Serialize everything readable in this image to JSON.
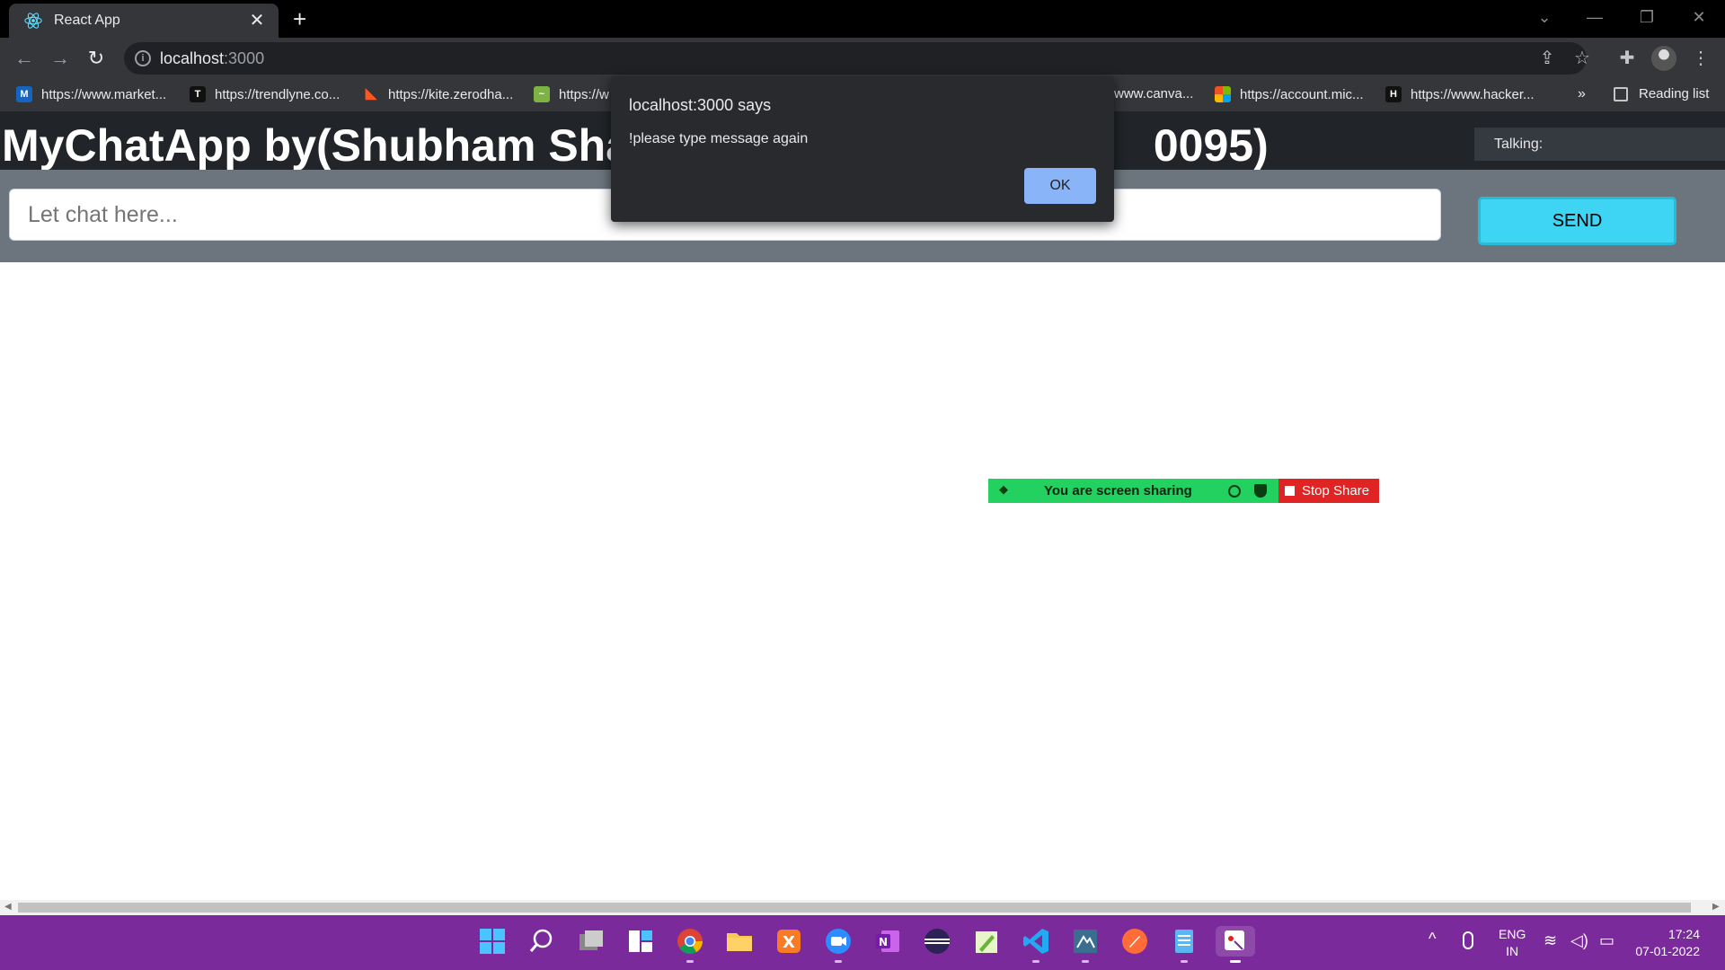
{
  "browser": {
    "tab_title": "React App",
    "tab_close": "✕",
    "new_tab": "+",
    "address": "localhost",
    "address_port": ":3000",
    "bookmarks": [
      {
        "label": "https://www.market...",
        "icon": "marketsmith-icon",
        "color": "#1565c0",
        "glyph": "M"
      },
      {
        "label": "https://trendlyne.co...",
        "icon": "trendlyne-icon",
        "color": "#111111",
        "glyph": "T"
      },
      {
        "label": "https://kite.zerodha...",
        "icon": "kite-icon",
        "color": "#ff5722",
        "glyph": "◣"
      },
      {
        "label": "https://w",
        "icon": "tradingview-icon",
        "color": "#7cb342",
        "glyph": "ꟿ"
      },
      {
        "label": "www.canva...",
        "icon": "canva-icon",
        "color": "#35363a",
        "glyph": ""
      },
      {
        "label": "https://account.mic...",
        "icon": "microsoft-icon",
        "color": "#f25022",
        "glyph": ""
      },
      {
        "label": "https://www.hacker...",
        "icon": "hackerrank-icon",
        "color": "#111111",
        "glyph": "H"
      }
    ],
    "bookmarks_more": "»",
    "reading_list": "Reading list"
  },
  "app": {
    "title_left": "MyChatApp by(Shubham Shas",
    "title_right": "0095)",
    "talking_label": "Talking:",
    "input_placeholder": "Let chat here...",
    "send_label": "SEND"
  },
  "alert": {
    "header": "localhost:3000 says",
    "message": "!please type message again",
    "ok_label": "OK"
  },
  "screen_share": {
    "status": "You are screen sharing",
    "stop_label": "Stop Share",
    "colors": {
      "bar": "#23d160",
      "stop": "#e02424"
    }
  },
  "taskbar": {
    "lang_line1": "ENG",
    "lang_line2": "IN",
    "time": "17:24",
    "date": "07-01-2022",
    "apps": [
      "start-icon",
      "search-icon",
      "task-view-icon",
      "widgets-icon",
      "chrome-icon",
      "file-explorer-icon",
      "xampp-icon",
      "zoom-icon",
      "onenote-icon",
      "eclipse-icon",
      "notepadpp-icon",
      "vscode-icon",
      "mysql-workbench-icon",
      "postman-icon",
      "notepad-icon",
      "snipping-tool-icon"
    ]
  }
}
